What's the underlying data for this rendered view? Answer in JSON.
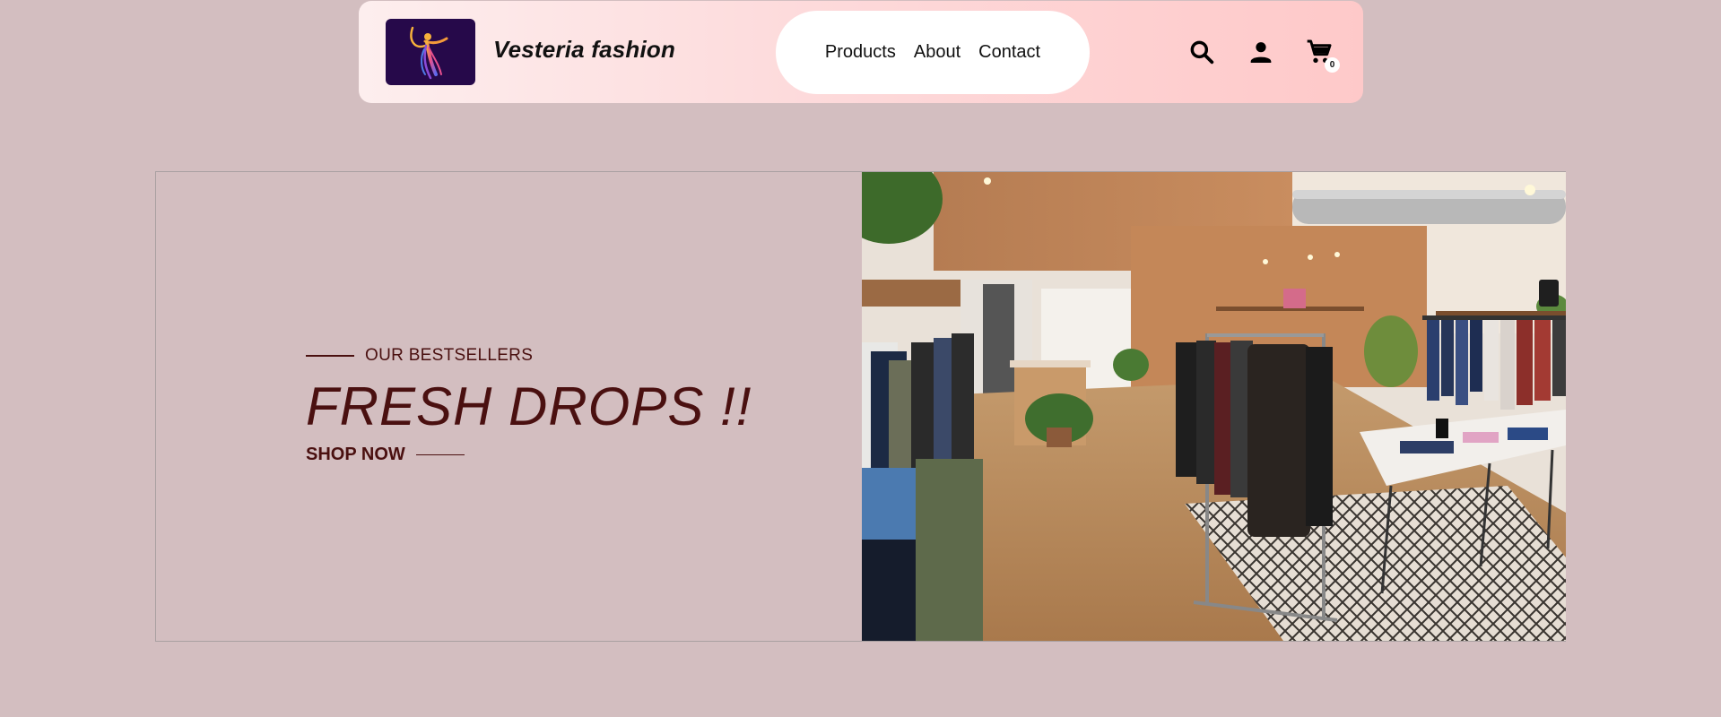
{
  "header": {
    "brand_name": "Vesteria fashion",
    "logo_icon": "dancer-logo",
    "nav": [
      {
        "label": "Products"
      },
      {
        "label": "About"
      },
      {
        "label": "Contact"
      }
    ],
    "icons": {
      "search": "search-icon",
      "account": "user-icon",
      "cart": "cart-icon"
    },
    "cart_count": "0"
  },
  "hero": {
    "eyebrow": "OUR BESTSELLERS",
    "title": "FRESH DROPS !!",
    "cta_label": "SHOP NOW",
    "image": "clothing-store-interior-photo"
  },
  "colors": {
    "page_background": "#d3bec0",
    "header_gradient_start": "#fdeeee",
    "header_gradient_end": "#fec9c9",
    "accent_text": "#4a1010",
    "logo_background": "#26094a"
  }
}
